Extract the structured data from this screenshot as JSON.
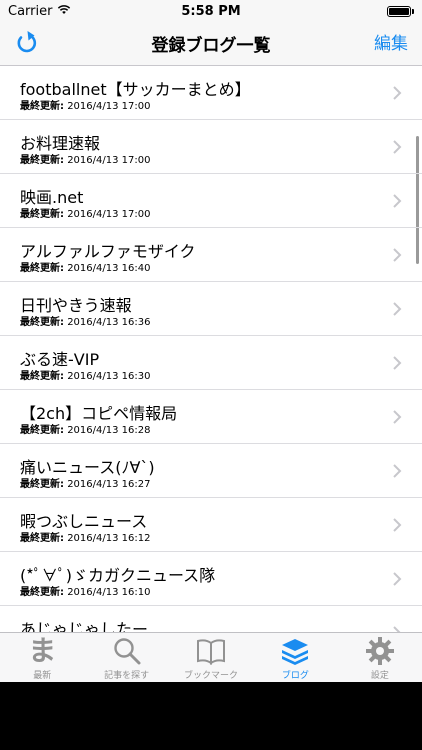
{
  "status_bar": {
    "carrier": "Carrier",
    "time": "5:58 PM"
  },
  "nav": {
    "title": "登録ブログ一覧",
    "edit_label": "編集"
  },
  "list": {
    "updated_label": "最終更新:",
    "items": [
      {
        "title": "footballnet【サッカーまとめ】",
        "updated": "2016/4/13 17:00"
      },
      {
        "title": "お料理速報",
        "updated": "2016/4/13 17:00"
      },
      {
        "title": "映画.net",
        "updated": "2016/4/13 17:00"
      },
      {
        "title": "アルファルファモザイク",
        "updated": "2016/4/13 16:40"
      },
      {
        "title": "日刊やきう速報",
        "updated": "2016/4/13 16:36"
      },
      {
        "title": "ぶる速-VIP",
        "updated": "2016/4/13 16:30"
      },
      {
        "title": "【2ch】コピペ情報局",
        "updated": "2016/4/13 16:28"
      },
      {
        "title": "痛いニュース(ﾉ∀`)",
        "updated": "2016/4/13 16:27"
      },
      {
        "title": "暇つぶしニュース",
        "updated": "2016/4/13 16:12"
      },
      {
        "title": "(*ﾟ∀ﾟ)ゞカガクニュース隊",
        "updated": "2016/4/13 16:10"
      },
      {
        "title": "あじゃじゃしたー",
        "updated": ""
      }
    ]
  },
  "tabs": [
    {
      "label": "最新",
      "icon": "ma-glyph-icon",
      "glyph": "ま",
      "active": false
    },
    {
      "label": "記事を探す",
      "icon": "search-icon",
      "active": false
    },
    {
      "label": "ブックマーク",
      "icon": "book-icon",
      "active": false
    },
    {
      "label": "ブログ",
      "icon": "stack-icon",
      "active": true
    },
    {
      "label": "設定",
      "icon": "gear-icon",
      "active": false
    }
  ],
  "colors": {
    "accent": "#1a8cf0",
    "inactive": "#929292"
  }
}
